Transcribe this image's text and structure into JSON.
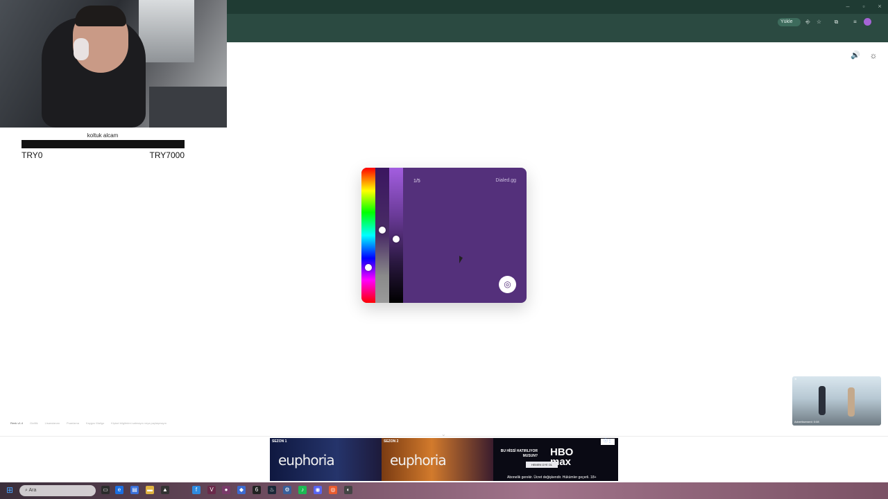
{
  "browser": {
    "install_label": "Yükle",
    "window_controls": [
      "–",
      "▫",
      "×"
    ],
    "toolbar_icons": [
      "translate-icon",
      "star-icon",
      "extensions-icon",
      "media-icon"
    ]
  },
  "donation": {
    "title": "koltuk alcam",
    "min": "TRY0",
    "max": "TRY7000"
  },
  "game": {
    "round": "1/5",
    "brand": "Dialed.gg",
    "submit_icon": "target-icon",
    "background_color": "#54307b",
    "hue_position": 0.74,
    "saturation_position": 0.46,
    "lightness_position": 0.53
  },
  "page_icons": {
    "sound": "🔊",
    "theme": "☼"
  },
  "footer": {
    "version": "Renk v1.4",
    "links": [
      "Gizlilik",
      "Lisanslanan",
      "Puanlama",
      "Kaygısı Mailgo",
      "Kişisel bilgilerimi satmayın veya paylaşmayın"
    ]
  },
  "video_ad": {
    "label": "Advertisement: 0:08",
    "close": "×"
  },
  "banner_ad": {
    "panels": [
      {
        "season": "SEZON 1",
        "show": "euphoria"
      },
      {
        "season": "SEZON 2",
        "show": "euphoria"
      }
    ],
    "hbo": {
      "tagline": "BU HİSSİ HATIRLIYOR MUSUN?",
      "logo_line1": "HBO",
      "logo_line2": "max",
      "cta": "HEMEN ÜYE OL",
      "disclaimer": "Abonelik gerekir. Ücret değişkendir. Hükümler geçerli. 18+"
    }
  },
  "taskbar": {
    "search_placeholder": "Ara"
  }
}
